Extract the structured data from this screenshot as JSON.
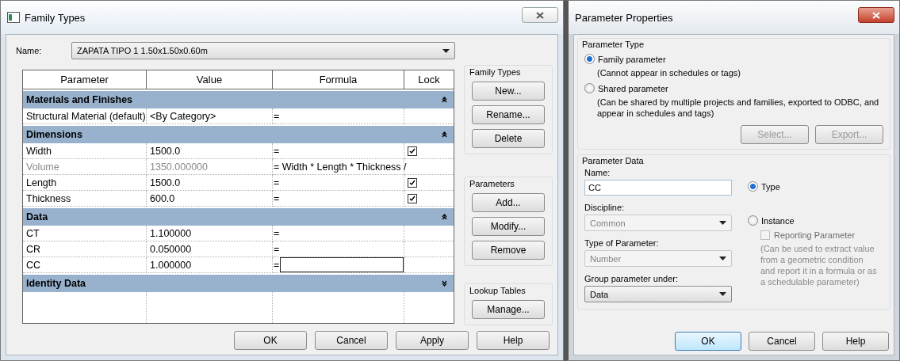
{
  "family_types": {
    "title": "Family Types",
    "name_label": "Name:",
    "name_value": "ZAPATA TIPO 1 1.50x1.50x0.60m",
    "table": {
      "columns": [
        "Parameter",
        "Value",
        "Formula",
        "Lock"
      ],
      "groups": [
        {
          "title": "Materials and Finishes",
          "expanded": true,
          "rows": [
            {
              "parameter": "Structural Material (default)",
              "value": "<By Category>",
              "formula": "=",
              "locked": false,
              "disabled": false,
              "editing": false
            }
          ]
        },
        {
          "title": "Dimensions",
          "expanded": true,
          "rows": [
            {
              "parameter": "Width",
              "value": "1500.0",
              "formula": "=",
              "locked": true,
              "disabled": false,
              "editing": false
            },
            {
              "parameter": "Volume",
              "value": "1350.000000",
              "formula": "= Width * Length * Thickness /",
              "locked": false,
              "disabled": true,
              "editing": false
            },
            {
              "parameter": "Length",
              "value": "1500.0",
              "formula": "=",
              "locked": true,
              "disabled": false,
              "editing": false
            },
            {
              "parameter": "Thickness",
              "value": "600.0",
              "formula": "=",
              "locked": true,
              "disabled": false,
              "editing": false
            }
          ]
        },
        {
          "title": "Data",
          "expanded": true,
          "rows": [
            {
              "parameter": "CT",
              "value": "1.100000",
              "formula": "=",
              "locked": false,
              "disabled": false,
              "editing": false
            },
            {
              "parameter": "CR",
              "value": "0.050000",
              "formula": "=",
              "locked": false,
              "disabled": false,
              "editing": false
            },
            {
              "parameter": "CC",
              "value": "1.000000",
              "formula": "=",
              "locked": false,
              "disabled": false,
              "editing": true
            }
          ]
        },
        {
          "title": "Identity Data",
          "expanded": false
        }
      ]
    },
    "side_groups": [
      {
        "title": "Family Types",
        "buttons": [
          "New...",
          "Rename...",
          "Delete"
        ]
      },
      {
        "title": "Parameters",
        "buttons": [
          "Add...",
          "Modify...",
          "Remove"
        ]
      },
      {
        "title": "Lookup Tables",
        "buttons": [
          "Manage..."
        ]
      }
    ],
    "buttons": [
      "OK",
      "Cancel",
      "Apply",
      "Help"
    ]
  },
  "parameter_properties": {
    "title": "Parameter Properties",
    "parameter_type": {
      "title": "Parameter Type",
      "options": [
        {
          "label": "Family parameter",
          "note": "(Cannot appear in schedules or tags)",
          "selected": true
        },
        {
          "label": "Shared parameter",
          "note": "(Can be shared by multiple projects and families, exported to ODBC, and appear in schedules and tags)",
          "selected": false
        }
      ],
      "buttons": [
        {
          "label": "Select...",
          "disabled": true
        },
        {
          "label": "Export...",
          "disabled": true
        }
      ]
    },
    "parameter_data": {
      "title": "Parameter Data",
      "name": {
        "label": "Name:",
        "value": "CC"
      },
      "discipline": {
        "label": "Discipline:",
        "value": "Common",
        "disabled": true
      },
      "type_of_parameter": {
        "label": "Type of Parameter:",
        "value": "Number",
        "disabled": true
      },
      "group_under": {
        "label": "Group parameter under:",
        "value": "Data",
        "disabled": false
      },
      "scope_options": [
        {
          "label": "Type",
          "selected": true
        },
        {
          "label": "Instance",
          "selected": false
        }
      ],
      "reporting": {
        "label": "Reporting Parameter",
        "checked": false,
        "disabled": true
      },
      "note": "(Can be used to extract value from a geometric condition and report it in a formula or as a schedulable parameter)"
    },
    "buttons": [
      {
        "label": "OK",
        "default": true
      },
      {
        "label": "Cancel",
        "default": false
      },
      {
        "label": "Help",
        "default": false
      }
    ]
  }
}
